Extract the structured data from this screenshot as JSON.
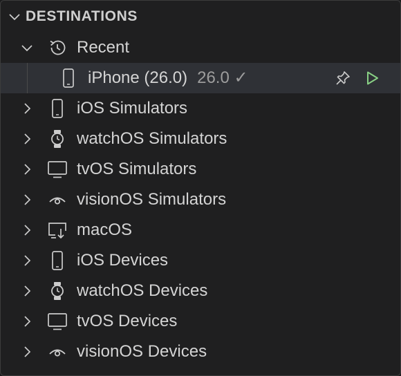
{
  "header": {
    "title": "DESTINATIONS",
    "chevron_icon": "chevron-down-icon"
  },
  "recent": {
    "label": "Recent",
    "icon": "history-icon",
    "items": [
      {
        "label": "iPhone (26.0)",
        "version": "26.0 ✓",
        "icon": "phone-icon",
        "pin_icon": "pin-icon",
        "run_icon": "play-icon"
      }
    ]
  },
  "groups": [
    {
      "label": "iOS Simulators",
      "icon": "phone-icon"
    },
    {
      "label": "watchOS Simulators",
      "icon": "watch-icon"
    },
    {
      "label": "tvOS Simulators",
      "icon": "monitor-icon"
    },
    {
      "label": "visionOS Simulators",
      "icon": "vision-eye-icon"
    },
    {
      "label": "macOS",
      "icon": "mac-display-icon"
    },
    {
      "label": "iOS Devices",
      "icon": "phone-icon"
    },
    {
      "label": "watchOS Devices",
      "icon": "watch-icon"
    },
    {
      "label": "tvOS Devices",
      "icon": "monitor-icon"
    },
    {
      "label": "visionOS Devices",
      "icon": "vision-eye-icon"
    }
  ],
  "colors": {
    "background": "#1f1f20",
    "selected_row": "#2f3136",
    "run_accent": "#89d185",
    "text": "#d4d4d4",
    "muted_text": "#9d9d9d"
  }
}
